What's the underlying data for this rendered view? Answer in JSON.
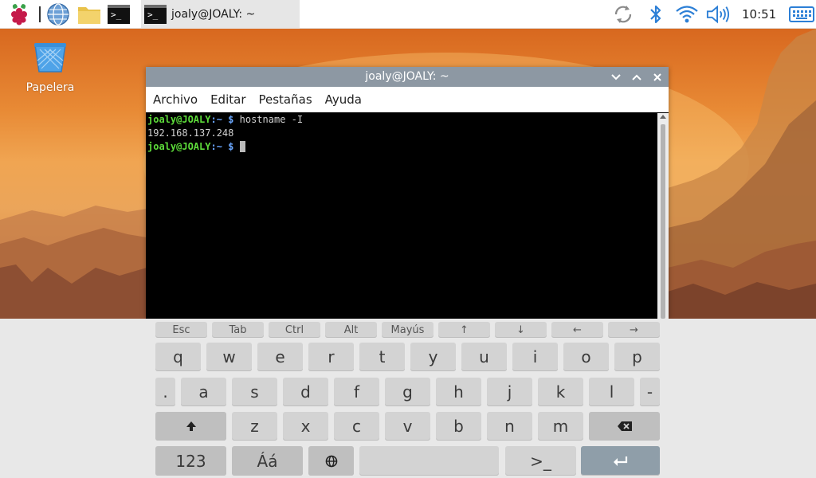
{
  "taskbar": {
    "launchers": [
      {
        "name": "raspberry-menu-icon"
      },
      {
        "name": "web-browser-icon"
      },
      {
        "name": "file-manager-icon"
      },
      {
        "name": "terminal-launcher-icon",
        "glyph": ">_"
      }
    ],
    "task_button": {
      "title": "joaly@JOALY: ~"
    },
    "tray": {
      "clock": "10:51"
    }
  },
  "desktop": {
    "trash_label": "Papelera"
  },
  "terminal": {
    "title": "joaly@JOALY: ~",
    "menu": [
      "Archivo",
      "Editar",
      "Pestañas",
      "Ayuda"
    ],
    "lines": [
      {
        "user": "joaly@JOALY",
        "path": ":~",
        "prompt": " $ ",
        "cmd": "hostname -I"
      },
      {
        "output": "192.168.137.248"
      },
      {
        "user": "joaly@JOALY",
        "path": ":~",
        "prompt": " $ ",
        "cmd": ""
      }
    ]
  },
  "keyboard": {
    "fn_row": [
      "Esc",
      "Tab",
      "Ctrl",
      "Alt",
      "Mayús",
      "↑",
      "↓",
      "←",
      "→"
    ],
    "row1": [
      "q",
      "w",
      "e",
      "r",
      "t",
      "y",
      "u",
      "i",
      "o",
      "p"
    ],
    "row2": [
      ".",
      "a",
      "s",
      "d",
      "f",
      "g",
      "h",
      "j",
      "k",
      "l",
      "-"
    ],
    "row3": [
      "z",
      "x",
      "c",
      "v",
      "b",
      "n",
      "m"
    ],
    "row4": {
      "numbers": "123",
      "accents": "Áá",
      "prompt": ">_"
    }
  },
  "colors": {
    "prompt_user": "#5ddc3a",
    "prompt_path": "#6aa7ff",
    "titlebar": "#8d98a3",
    "enter_key": "#8f9ea9"
  }
}
